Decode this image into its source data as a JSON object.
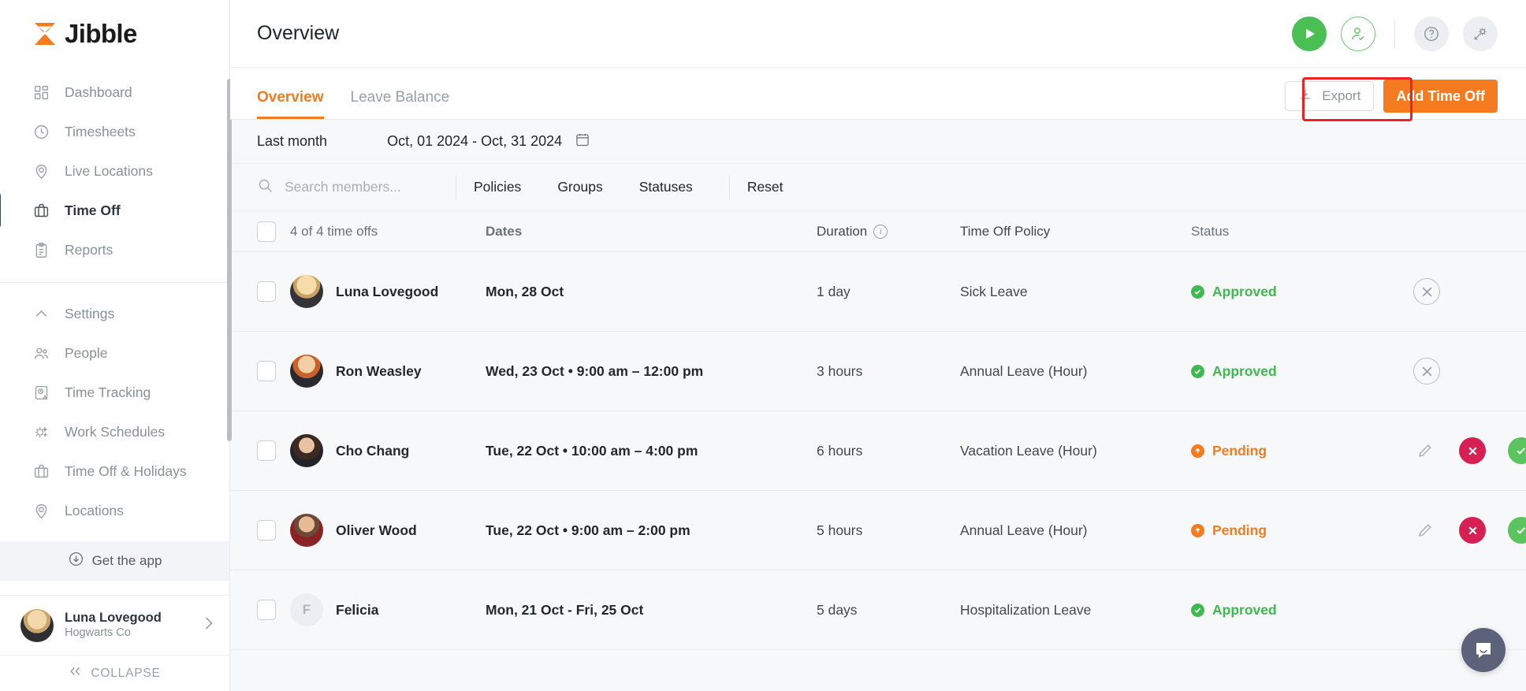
{
  "sidebar": {
    "logo_text": "Jibble",
    "items_primary": [
      {
        "label": "Dashboard",
        "icon": "dashboard-icon",
        "active": false
      },
      {
        "label": "Timesheets",
        "icon": "clock-icon",
        "active": false
      },
      {
        "label": "Live Locations",
        "icon": "location-pin-icon",
        "active": false
      },
      {
        "label": "Time Off",
        "icon": "briefcase-icon",
        "active": true
      },
      {
        "label": "Reports",
        "icon": "clipboard-icon",
        "active": false
      }
    ],
    "items_secondary": [
      {
        "label": "Settings",
        "icon": "chevron-up-icon",
        "active": false
      },
      {
        "label": "People",
        "icon": "people-icon",
        "active": false
      },
      {
        "label": "Time Tracking",
        "icon": "time-tracking-icon",
        "active": false
      },
      {
        "label": "Work Schedules",
        "icon": "work-schedules-icon",
        "active": false
      },
      {
        "label": "Time Off & Holidays",
        "icon": "briefcase-icon",
        "active": false
      },
      {
        "label": "Locations",
        "icon": "location-pin-icon",
        "active": false
      }
    ],
    "get_the_app": "Get the app",
    "user_name": "Luna Lovegood",
    "user_org": "Hogwarts Co",
    "collapse_label": "COLLAPSE"
  },
  "topbar": {
    "page_title": "Overview",
    "icons": [
      "play-icon",
      "person-check-icon",
      "help-icon",
      "settings-gear-icon"
    ]
  },
  "tabs": [
    {
      "label": "Overview",
      "active": true
    },
    {
      "label": "Leave Balance",
      "active": false
    }
  ],
  "actions": {
    "export_label": "Export",
    "add_time_off_label": "Add Time Off"
  },
  "filters": {
    "period_label": "Last month",
    "date_range": "Oct, 01 2024 - Oct, 31 2024",
    "search_placeholder": "Search members...",
    "search_value": "",
    "policies_label": "Policies",
    "groups_label": "Groups",
    "statuses_label": "Statuses",
    "reset_label": "Reset"
  },
  "table": {
    "headers": {
      "count": "4 of 4 time offs",
      "dates": "Dates",
      "duration": "Duration",
      "policy": "Time Off Policy",
      "status": "Status"
    },
    "rows": [
      {
        "member": "Luna Lovegood",
        "avatar_type": "photo-luna",
        "dates": "Mon, 28 Oct",
        "duration": "1 day",
        "policy": "Sick Leave",
        "status": "Approved",
        "status_kind": "approved",
        "actions": [
          "cancel-circle-icon"
        ]
      },
      {
        "member": "Ron Weasley",
        "avatar_type": "photo-ron",
        "dates": "Wed, 23 Oct • 9:00 am – 12:00 pm",
        "duration": "3 hours",
        "policy": "Annual Leave (Hour)",
        "status": "Approved",
        "status_kind": "approved",
        "actions": [
          "cancel-circle-icon"
        ]
      },
      {
        "member": "Cho Chang",
        "avatar_type": "photo-cho",
        "dates": "Tue, 22 Oct • 10:00 am – 4:00 pm",
        "duration": "6 hours",
        "policy": "Vacation Leave (Hour)",
        "status": "Pending",
        "status_kind": "pending",
        "actions": [
          "edit-pencil-icon",
          "reject-icon",
          "approve-icon"
        ]
      },
      {
        "member": "Oliver Wood",
        "avatar_type": "photo-oliver",
        "dates": "Tue, 22 Oct • 9:00 am – 2:00 pm",
        "duration": "5 hours",
        "policy": "Annual Leave (Hour)",
        "status": "Pending",
        "status_kind": "pending",
        "actions": [
          "edit-pencil-icon",
          "reject-icon",
          "approve-icon"
        ]
      },
      {
        "member": "Felicia",
        "avatar_type": "initial",
        "avatar_initial": "F",
        "dates": "Mon, 21 Oct - Fri, 25 Oct",
        "duration": "5 days",
        "policy": "Hospitalization Leave",
        "status": "Approved",
        "status_kind": "approved",
        "actions": []
      }
    ]
  },
  "colors": {
    "brand_orange": "#f47b20",
    "approved_green": "#3fb950",
    "pending_orange": "#f47b20",
    "reject_red": "#d61f52",
    "approve_green": "#5cc45e",
    "highlight_red": "#ef2222"
  },
  "chat": {
    "icon": "chat-bubble-icon"
  }
}
